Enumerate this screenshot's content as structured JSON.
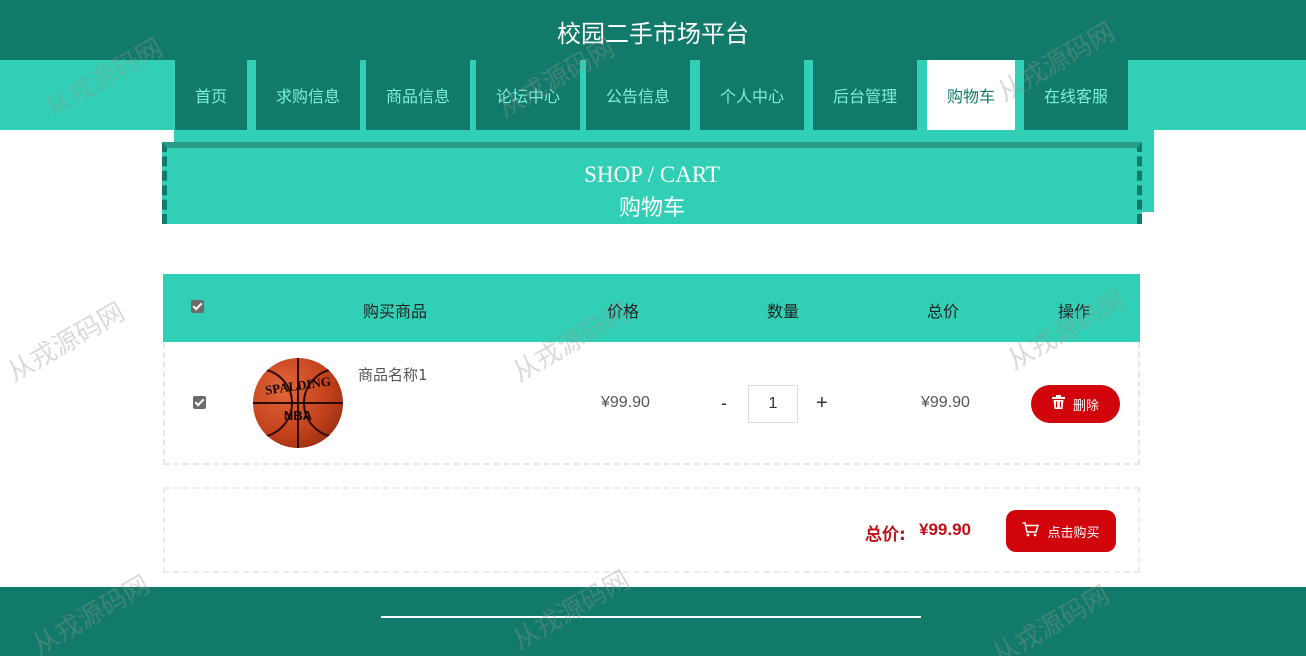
{
  "header": {
    "site_title": "校园二手市场平台"
  },
  "nav": {
    "items": [
      {
        "label": "首页"
      },
      {
        "label": "求购信息"
      },
      {
        "label": "商品信息"
      },
      {
        "label": "论坛中心"
      },
      {
        "label": "公告信息"
      },
      {
        "label": "个人中心"
      },
      {
        "label": "后台管理"
      },
      {
        "label": "购物车",
        "active": true
      },
      {
        "label": "在线客服"
      }
    ]
  },
  "banner": {
    "title_en": "SHOP / CART",
    "title_cn": "购物车"
  },
  "cart": {
    "columns": [
      "购买商品",
      "价格",
      "数量",
      "总价",
      "操作"
    ],
    "select_all_checked": true,
    "items": [
      {
        "checked": true,
        "name": "商品名称1",
        "image": "basketball-image",
        "image_text": [
          "SPALDING",
          "NBA"
        ],
        "price": "¥99.90",
        "quantity": "1",
        "subtotal": "¥99.90",
        "delete_label": "删除"
      }
    ],
    "quantity_minus": "-",
    "quantity_plus": "+"
  },
  "summary": {
    "total_label": "总价:",
    "total_value": "¥99.90",
    "buy_label": "点击购买"
  },
  "watermark": "从戎源码网",
  "colors": {
    "primary_dark": "#127a6a",
    "primary_light": "#31d0b6",
    "danger": "#d1040c"
  }
}
